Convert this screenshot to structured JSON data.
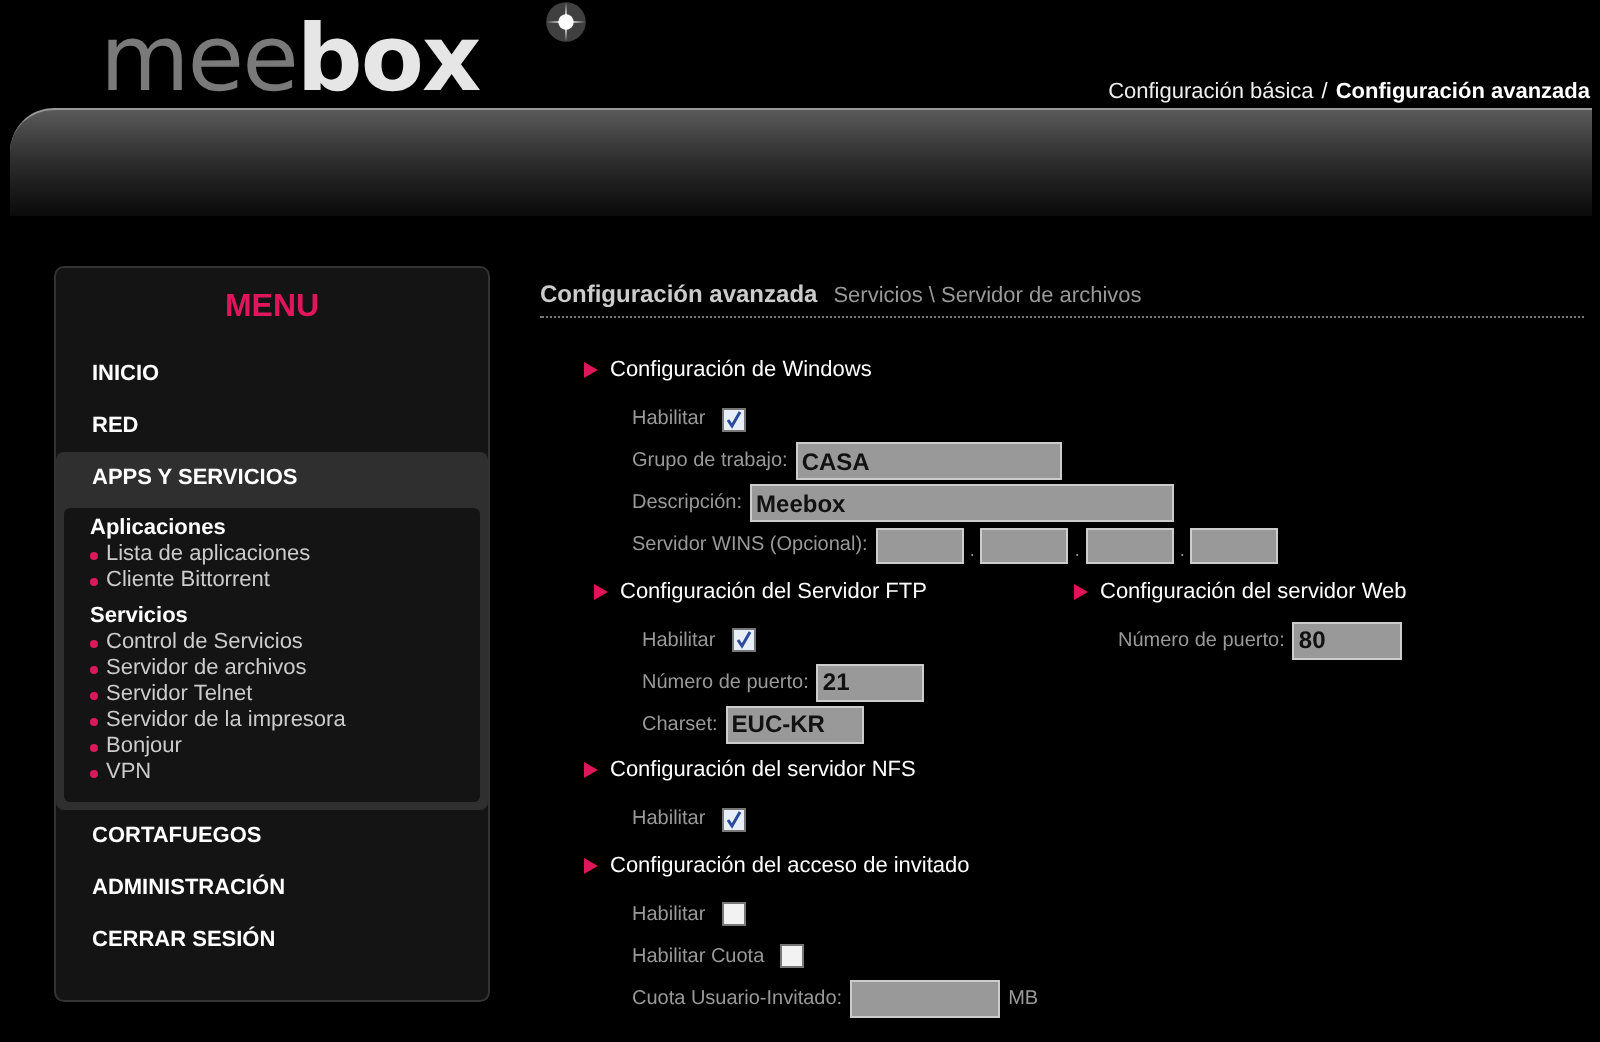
{
  "header": {
    "logo": "meebox",
    "links": [
      {
        "label": "Configuración básica",
        "selected": false
      },
      {
        "label": "Configuración avanzada",
        "selected": true
      }
    ],
    "separator": "/"
  },
  "menu": {
    "title": "MENU",
    "items": [
      {
        "label": "INICIO",
        "expanded": false
      },
      {
        "label": "RED",
        "expanded": false
      },
      {
        "label": "APPS Y SERVICIOS",
        "expanded": true,
        "groups": [
          {
            "title": "Aplicaciones",
            "items": [
              "Lista de aplicaciones",
              "Cliente Bittorrent"
            ]
          },
          {
            "title": "Servicios",
            "items": [
              "Control de Servicios",
              "Servidor de archivos",
              "Servidor Telnet",
              "Servidor de la impresora",
              "Bonjour",
              "VPN"
            ]
          }
        ]
      },
      {
        "label": "CORTAFUEGOS",
        "expanded": false
      },
      {
        "label": "ADMINISTRACIÓN",
        "expanded": false
      },
      {
        "label": "CERRAR SESIÓN",
        "expanded": false
      }
    ]
  },
  "content": {
    "title": "Configuración avanzada",
    "breadcrumb": "Servicios \\ Servidor de archivos",
    "section_rows": [
      [
        {
          "title": "Configuración de Windows",
          "fields": [
            {
              "kind": "checkbox",
              "label": "Habilitar",
              "checked": true
            },
            {
              "kind": "text",
              "label": "Grupo de trabajo:",
              "value": "CASA"
            },
            {
              "kind": "text",
              "label": "Descripción:",
              "value": "Meebox"
            },
            {
              "kind": "ip",
              "label": "Servidor WINS (Opcional):",
              "separator": "."
            }
          ]
        }
      ],
      [
        {
          "title": "Configuración del Servidor FTP",
          "fields": [
            {
              "kind": "checkbox",
              "label": "Habilitar",
              "checked": true
            },
            {
              "kind": "text",
              "label": "Número de puerto:",
              "value": "21"
            },
            {
              "kind": "text",
              "label": "Charset:",
              "value": "EUC-KR"
            }
          ]
        },
        {
          "title": "Configuración del servidor Web",
          "fields": [
            {
              "kind": "text",
              "label": "Número de puerto:",
              "value": "80"
            }
          ]
        }
      ],
      [
        {
          "title": "Configuración del servidor NFS",
          "fields": [
            {
              "kind": "checkbox",
              "label": "Habilitar",
              "checked": true
            }
          ]
        }
      ],
      [
        {
          "title": "Configuración del acceso de invitado",
          "fields": [
            {
              "kind": "checkbox",
              "label": "Habilitar",
              "checked": false
            },
            {
              "kind": "checkbox",
              "label": "Habilitar Cuota",
              "checked": false
            },
            {
              "kind": "text",
              "label": "Cuota Usuario-Invitado:",
              "unit": "MB"
            }
          ]
        }
      ]
    ]
  }
}
